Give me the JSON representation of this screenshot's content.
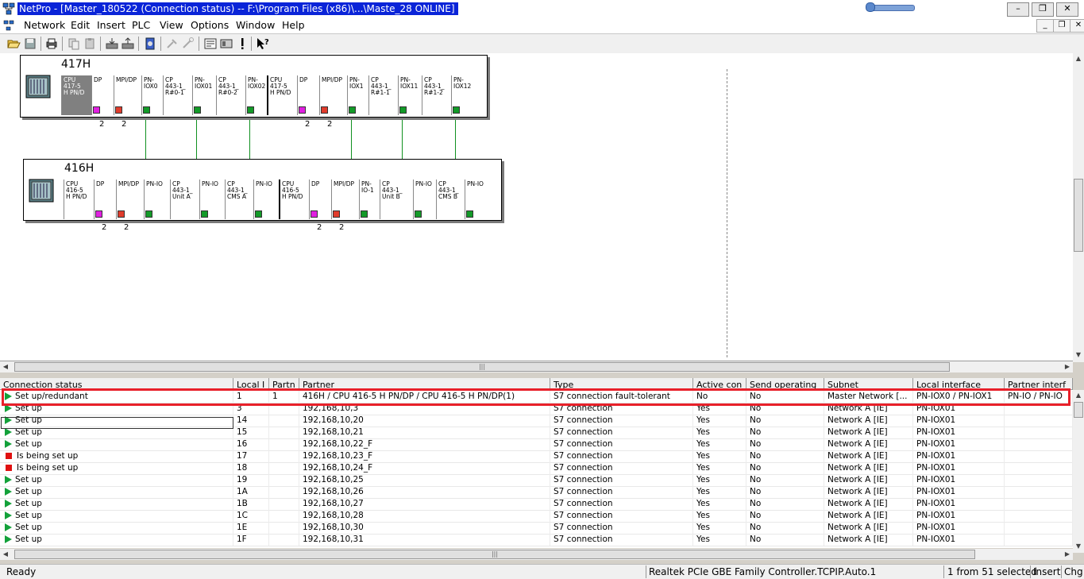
{
  "window": {
    "title": "NetPro - [Master_180522 (Connection status) -- F:\\Program Files (x86)\\...\\Maste_28  ONLINE]",
    "buttons": {
      "minimize": "–",
      "restore": "❐",
      "close": "✕"
    }
  },
  "menu": {
    "items": [
      "Network",
      "Edit",
      "Insert",
      "PLC",
      "View",
      "Options",
      "Window",
      "Help"
    ],
    "mdi_buttons": {
      "minimize": "_",
      "restore": "❐",
      "close": "✕"
    }
  },
  "toolbar": {
    "icons": [
      "open-folder-icon",
      "save-icon",
      "print-icon",
      "copy-icon",
      "paste-icon",
      "download-icon",
      "upload-icon",
      "network-config-icon",
      "disabled-tool-icon",
      "disabled-tool-icon-2",
      "properties-icon",
      "station-icon",
      "exclamation-icon",
      "help-pointer-icon"
    ]
  },
  "stations": [
    {
      "name": "417H",
      "slots": [
        {
          "label": "CPU\n417-5\nH PN/D",
          "port": "",
          "selected": true
        },
        {
          "label": "DP",
          "port": "magenta",
          "num": "2"
        },
        {
          "label": "MPI/DP",
          "port": "red",
          "num": "2"
        },
        {
          "label": "PN-\nIOX0",
          "port": "green"
        },
        {
          "label": "CP\n443-1_\nR#0-1",
          "port": ""
        },
        {
          "label": "PN-\nIOX01",
          "port": "green"
        },
        {
          "label": "CP\n443-1_\nR#0-2",
          "port": ""
        },
        {
          "label": "PN-\nIOX02",
          "port": "green"
        },
        {
          "label": "CPU\n417-5\nH PN/D",
          "port": ""
        },
        {
          "label": "DP",
          "port": "magenta",
          "num": "2"
        },
        {
          "label": "MPI/DP",
          "port": "red",
          "num": "2"
        },
        {
          "label": "PN-\nIOX1",
          "port": "green"
        },
        {
          "label": "CP\n443-1_\nR#1-1",
          "port": ""
        },
        {
          "label": "PN-\nIOX11",
          "port": "green"
        },
        {
          "label": "CP\n443-1_\nR#1-2",
          "port": ""
        },
        {
          "label": "PN-\nIOX12",
          "port": "green"
        }
      ]
    },
    {
      "name": "416H",
      "slots": [
        {
          "label": "CPU\n416-5\nH PN/D",
          "port": ""
        },
        {
          "label": "DP",
          "port": "magenta",
          "num": "2"
        },
        {
          "label": "MPI/DP",
          "port": "red",
          "num": "2"
        },
        {
          "label": "PN-IO",
          "port": "green"
        },
        {
          "label": "CP\n443-1_\nUnit A",
          "port": ""
        },
        {
          "label": "PN-IO",
          "port": "green"
        },
        {
          "label": "CP\n443-1_\nCMS A",
          "port": ""
        },
        {
          "label": "PN-IO",
          "port": "green"
        },
        {
          "label": "CPU\n416-5\nH PN/D",
          "port": ""
        },
        {
          "label": "DP",
          "port": "magenta",
          "num": "2"
        },
        {
          "label": "MPI/DP",
          "port": "red",
          "num": "2"
        },
        {
          "label": "PN-\nIO-1",
          "port": "green"
        },
        {
          "label": "CP\n443-1_\nUnit B",
          "port": ""
        },
        {
          "label": "PN-IO",
          "port": "green"
        },
        {
          "label": "CP\n443-1_\nCMS B",
          "port": ""
        },
        {
          "label": "PN-IO",
          "port": "green"
        }
      ]
    }
  ],
  "table": {
    "headers": [
      "Connection status",
      "Local I",
      "Partn",
      "Partner",
      "Type",
      "Active con",
      "Send operating",
      "Subnet",
      "Local interface",
      "Partner interf"
    ],
    "rows": [
      {
        "icon": "play",
        "status": "Set up/redundant",
        "local_id": "1",
        "partner_id": "1",
        "partner": "416H / CPU 416-5 H PN/DP / CPU 416-5 H PN/DP(1)",
        "type": "S7 connection fault-tolerant",
        "active": "No",
        "send": "No",
        "subnet": "Master Network [...",
        "local_if": "PN-IOX0 / PN-IOX1",
        "partner_if": "PN-IO / PN-IO"
      },
      {
        "icon": "play",
        "status": "Set up",
        "local_id": "3",
        "partner_id": "",
        "partner": "192,168,10,3",
        "type": "S7 connection",
        "active": "Yes",
        "send": "No",
        "subnet": "Network A [IE]",
        "local_if": "PN-IOX01",
        "partner_if": ""
      },
      {
        "icon": "play",
        "status": "Set up",
        "local_id": "14",
        "partner_id": "",
        "partner": "192,168,10,20",
        "type": "S7 connection",
        "active": "Yes",
        "send": "No",
        "subnet": "Network A [IE]",
        "local_if": "PN-IOX01",
        "partner_if": ""
      },
      {
        "icon": "play",
        "status": "Set up",
        "local_id": "15",
        "partner_id": "",
        "partner": "192,168,10,21",
        "type": "S7 connection",
        "active": "Yes",
        "send": "No",
        "subnet": "Network A [IE]",
        "local_if": "PN-IOX01",
        "partner_if": ""
      },
      {
        "icon": "play",
        "status": "Set up",
        "local_id": "16",
        "partner_id": "",
        "partner": "192,168,10,22_F",
        "type": "S7 connection",
        "active": "Yes",
        "send": "No",
        "subnet": "Network A [IE]",
        "local_if": "PN-IOX01",
        "partner_if": ""
      },
      {
        "icon": "stop",
        "status": "Is being set up",
        "local_id": "17",
        "partner_id": "",
        "partner": "192,168,10,23_F",
        "type": "S7 connection",
        "active": "Yes",
        "send": "No",
        "subnet": "Network A [IE]",
        "local_if": "PN-IOX01",
        "partner_if": ""
      },
      {
        "icon": "stop",
        "status": "Is being set up",
        "local_id": "18",
        "partner_id": "",
        "partner": "192,168,10,24_F",
        "type": "S7 connection",
        "active": "Yes",
        "send": "No",
        "subnet": "Network A [IE]",
        "local_if": "PN-IOX01",
        "partner_if": ""
      },
      {
        "icon": "play",
        "status": "Set up",
        "local_id": "19",
        "partner_id": "",
        "partner": "192,168,10,25",
        "type": "S7 connection",
        "active": "Yes",
        "send": "No",
        "subnet": "Network A [IE]",
        "local_if": "PN-IOX01",
        "partner_if": ""
      },
      {
        "icon": "play",
        "status": "Set up",
        "local_id": "1A",
        "partner_id": "",
        "partner": "192,168,10,26",
        "type": "S7 connection",
        "active": "Yes",
        "send": "No",
        "subnet": "Network A [IE]",
        "local_if": "PN-IOX01",
        "partner_if": ""
      },
      {
        "icon": "play",
        "status": "Set up",
        "local_id": "1B",
        "partner_id": "",
        "partner": "192,168,10,27",
        "type": "S7 connection",
        "active": "Yes",
        "send": "No",
        "subnet": "Network A [IE]",
        "local_if": "PN-IOX01",
        "partner_if": ""
      },
      {
        "icon": "play",
        "status": "Set up",
        "local_id": "1C",
        "partner_id": "",
        "partner": "192,168,10,28",
        "type": "S7 connection",
        "active": "Yes",
        "send": "No",
        "subnet": "Network A [IE]",
        "local_if": "PN-IOX01",
        "partner_if": ""
      },
      {
        "icon": "play",
        "status": "Set up",
        "local_id": "1E",
        "partner_id": "",
        "partner": "192,168,10,30",
        "type": "S7 connection",
        "active": "Yes",
        "send": "No",
        "subnet": "Network A [IE]",
        "local_if": "PN-IOX01",
        "partner_if": ""
      },
      {
        "icon": "play",
        "status": "Set up",
        "local_id": "1F",
        "partner_id": "",
        "partner": "192,168,10,31",
        "type": "S7 connection",
        "active": "Yes",
        "send": "No",
        "subnet": "Network A [IE]",
        "local_if": "PN-IOX01",
        "partner_if": ""
      }
    ]
  },
  "statusbar": {
    "ready": "Ready",
    "interface": "Realtek PCIe GBE Family Controller.TCPIP.Auto.1",
    "selection": "1 from 51 selected",
    "insert": "Insert",
    "chg": "Chg"
  },
  "colors": {
    "highlight": "#e8202a",
    "title_bg": "#0a24d8",
    "port_green": "#139a28",
    "port_red": "#e03c2c",
    "port_magenta": "#e020e0"
  }
}
